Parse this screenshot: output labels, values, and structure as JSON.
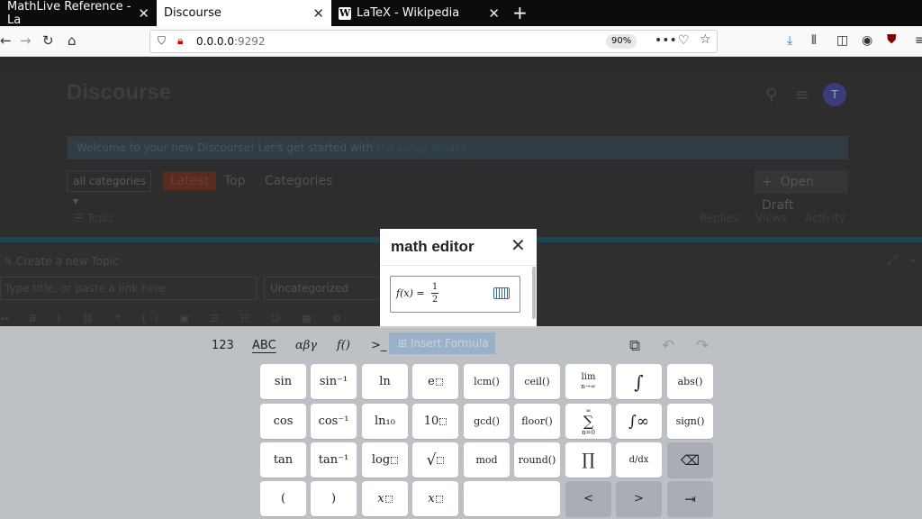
{
  "browser": {
    "tabs": [
      {
        "title": "MathLive Reference - La",
        "active": false
      },
      {
        "title": "Discourse",
        "active": true
      },
      {
        "title": "LaTeX - Wikipedia",
        "active": false
      }
    ],
    "url_host": "0.0.0.0",
    "url_port": ":9292",
    "zoom": "90%",
    "colors": {
      "tabbar": "#0c0c0d",
      "download_icon": "#0a84ff",
      "ublock": "#800000"
    }
  },
  "discourse": {
    "logo": "Discourse",
    "avatar_letter": "T",
    "banner_text": "Welcome to your new Discourse! Let's get started with",
    "banner_link": "the setup wizard",
    "category_select": "all categories",
    "nav": [
      "Latest",
      "Top",
      "Categories"
    ],
    "open_draft": "Open Draft",
    "columns": {
      "topic": "Topic",
      "replies": "Replies",
      "views": "Views",
      "activity": "Activity"
    },
    "composer": {
      "title": "Create a new Topic",
      "title_placeholder": "Type title, or paste a link here",
      "category": "Uncategorized"
    }
  },
  "math_editor": {
    "title": "math editor",
    "close": "✕",
    "formula_lhs": "f(x) =",
    "frac_num": "1",
    "frac_den": "2",
    "insert_label": "Insert Formula"
  },
  "keyboard": {
    "layers": [
      "123",
      "ABC",
      "αβγ",
      "f()",
      ">_"
    ],
    "rows": [
      [
        "sin",
        "sin⁻¹",
        "ln",
        "e",
        "lcm()",
        "ceil()",
        "lim",
        "∫",
        "abs()"
      ],
      [
        "cos",
        "cos⁻¹",
        "ln₁₀",
        "10",
        "gcd()",
        "floor()",
        "∑",
        "∫∞",
        "sign()"
      ],
      [
        "tan",
        "tan⁻¹",
        "log",
        "√",
        "mod",
        "round()",
        "∏",
        "d/dx",
        "⌫"
      ],
      [
        "(",
        ")",
        "x",
        "x",
        "",
        "<",
        ">",
        "⇥"
      ]
    ]
  }
}
